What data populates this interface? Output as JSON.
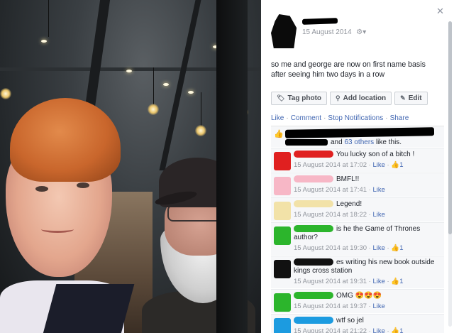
{
  "post": {
    "date": "15 August 2014",
    "privacy_icon": "gear-icon",
    "text": "so me and george are now on first name basis after seeing him two days in a row"
  },
  "actions": {
    "tag": "Tag photo",
    "location": "Add location",
    "edit": "Edit"
  },
  "links": {
    "like": "Like",
    "comment": "Comment",
    "stop": "Stop Notifications",
    "share": "Share"
  },
  "likes": {
    "prefix": "and ",
    "others": "63 others",
    "suffix": " like this."
  },
  "comments": [
    {
      "text": "You lucky son of a bitch !",
      "time": "15 August 2014 at 17:02",
      "like": "Like",
      "count": "1",
      "color": "#e02020"
    },
    {
      "text": "BMFL!!",
      "time": "15 August 2014 at 17:41",
      "like": "Like",
      "count": "",
      "color": "#f7b7c6"
    },
    {
      "text": "Legend!",
      "time": "15 August 2014 at 18:22",
      "like": "Like",
      "count": "",
      "color": "#f2e2a8"
    },
    {
      "text": "is he the Game of Thrones author?",
      "time": "15 August 2014 at 19:30",
      "like": "Like",
      "count": "1",
      "color": "#2cb52c"
    },
    {
      "text": "es writing his new book outside kings cross station",
      "time": "15 August 2014 at 19:31",
      "like": "Like",
      "count": "1",
      "color": "#111111"
    },
    {
      "text": "OMG 😍😍😍",
      "time": "15 August 2014 at 19:37",
      "like": "Like",
      "count": "",
      "color": "#2cb52c"
    },
    {
      "text": "wtf so jel",
      "time": "15 August 2014 at 21:22",
      "like": "Like",
      "count": "1",
      "color": "#1c9be0"
    }
  ]
}
